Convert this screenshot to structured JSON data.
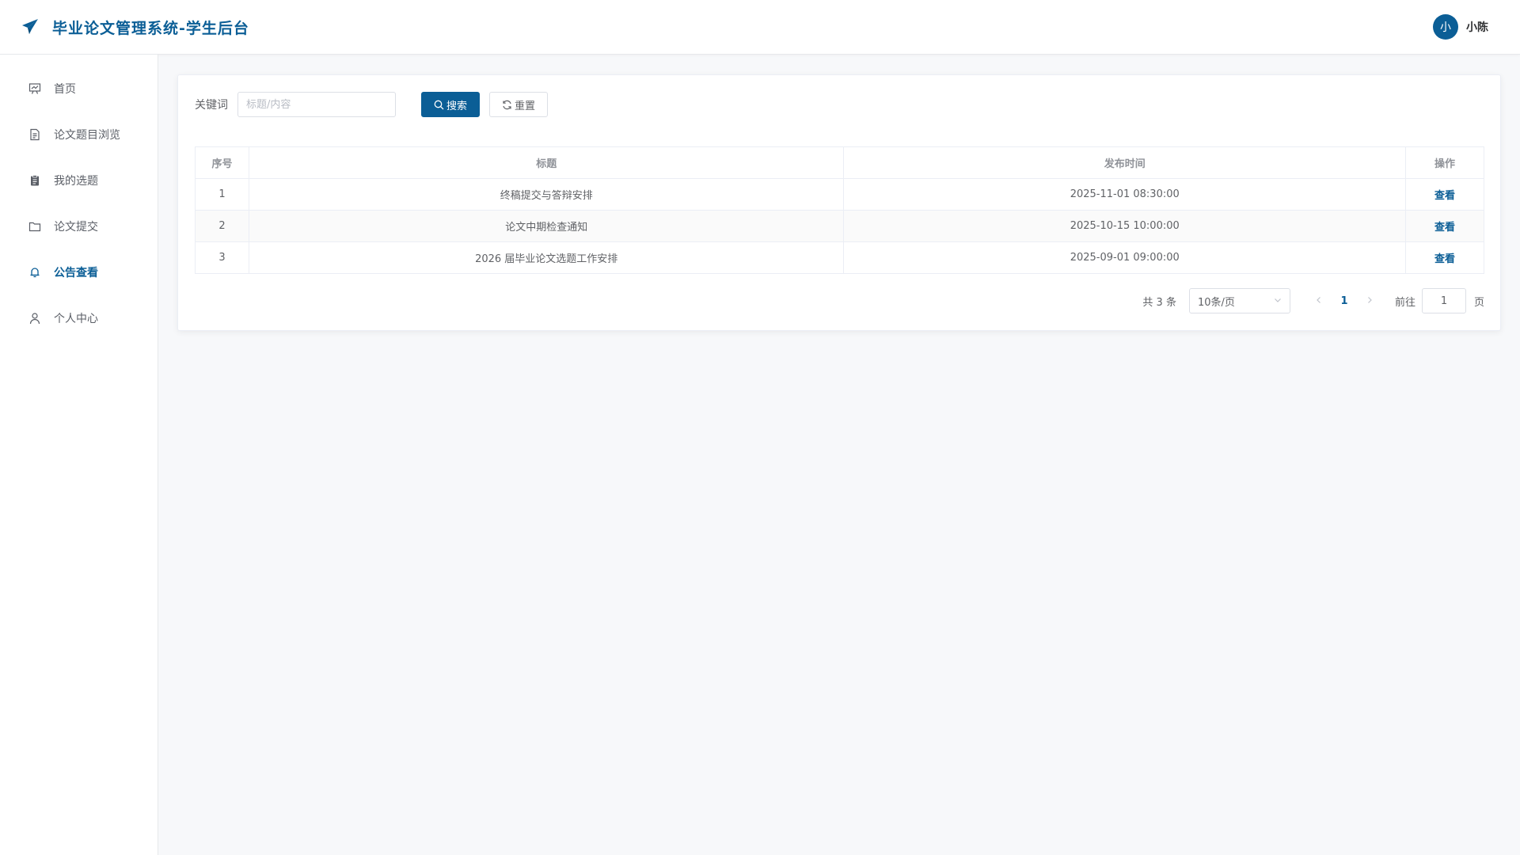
{
  "app": {
    "title": "毕业论文管理系统-学生后台"
  },
  "user": {
    "avatar_text": "小",
    "name": "小陈"
  },
  "sidebar": {
    "items": [
      {
        "label": "首页",
        "icon": "presentation-icon",
        "active": false
      },
      {
        "label": "论文题目浏览",
        "icon": "document-icon",
        "active": false
      },
      {
        "label": "我的选题",
        "icon": "clipboard-icon",
        "active": false
      },
      {
        "label": "论文提交",
        "icon": "folder-icon",
        "active": false
      },
      {
        "label": "公告查看",
        "icon": "bell-icon",
        "active": true
      },
      {
        "label": "个人中心",
        "icon": "user-icon",
        "active": false
      }
    ]
  },
  "search": {
    "label": "关键词",
    "placeholder": "标题/内容",
    "value": "",
    "search_button": "搜索",
    "reset_button": "重置"
  },
  "table": {
    "headers": [
      "序号",
      "标题",
      "发布时间",
      "操作"
    ],
    "rows": [
      {
        "index": "1",
        "title": "终稿提交与答辩安排",
        "time": "2025-11-01 08:30:00",
        "action": "查看"
      },
      {
        "index": "2",
        "title": "论文中期检查通知",
        "time": "2025-10-15 10:00:00",
        "action": "查看"
      },
      {
        "index": "3",
        "title": "2026 届毕业论文选题工作安排",
        "time": "2025-09-01 09:00:00",
        "action": "查看"
      }
    ]
  },
  "pagination": {
    "total_text": "共 3 条",
    "page_size": "10条/页",
    "current_page": "1",
    "goto_label": "前往",
    "goto_value": "1",
    "page_suffix": "页"
  },
  "colors": {
    "primary": "#0b5e96",
    "background": "#f7f8fa"
  }
}
